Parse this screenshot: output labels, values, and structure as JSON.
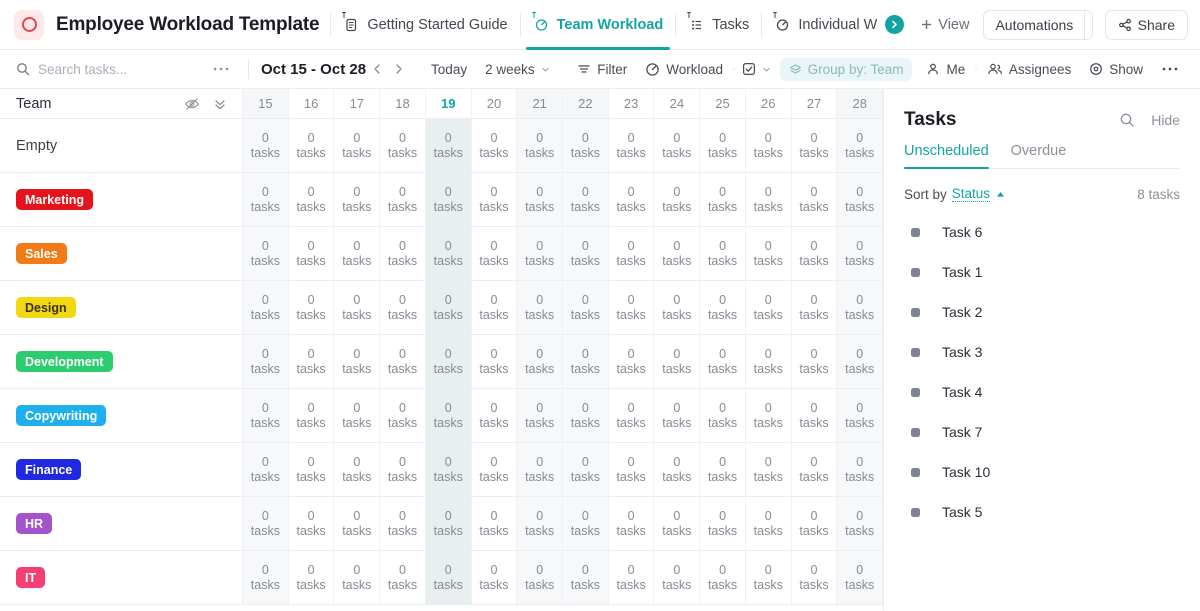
{
  "header": {
    "logo_icon": "clickup-ring-icon",
    "doc_title": "Employee Workload Template",
    "tabs": [
      {
        "label": "Getting Started Guide",
        "icon": "pinned-doc-icon",
        "active": false
      },
      {
        "label": "Team Workload",
        "icon": "pinned-workload-icon",
        "active": true
      },
      {
        "label": "Tasks",
        "icon": "pinned-list-icon",
        "active": false
      },
      {
        "label": "Individual W",
        "icon": "pinned-workload-icon",
        "active": false
      }
    ],
    "more_views_icon": "chevron-right-circle-icon",
    "add_view_label": "View",
    "add_view_icon": "plus-icon",
    "automations_label": "Automations",
    "automations_caret_icon": "chevron-down-icon",
    "share_label": "Share",
    "share_icon": "share-icon",
    "accent_color": "#14a3a3"
  },
  "toolbar": {
    "search_placeholder": "Search tasks...",
    "search_value": "",
    "search_icon": "search-icon",
    "overflow_icon": "ellipsis-icon",
    "date_range": "Oct 15 - Oct 28",
    "prev_icon": "chevron-left-icon",
    "next_icon": "chevron-right-icon",
    "today_label": "Today",
    "zoom_label": "2 weeks",
    "zoom_caret_icon": "caret-down-icon",
    "filter_label": "Filter",
    "filter_icon": "filter-icon",
    "workload_label": "Workload",
    "workload_icon": "gauge-icon",
    "checkbox_icon": "checkbox-checked-icon",
    "checkbox_caret_icon": "caret-down-icon",
    "groupby_label": "Group by: Team",
    "groupby_icon": "layers-icon",
    "me_label": "Me",
    "me_icon": "person-icon",
    "assignees_label": "Assignees",
    "assignees_icon": "people-icon",
    "show_label": "Show",
    "show_icon": "eye-circle-icon",
    "more_icon": "ellipsis-icon"
  },
  "grid": {
    "team_header": "Team",
    "hide_icon": "eye-off-icon",
    "collapse_icon": "double-chevron-down-icon",
    "days": [
      {
        "label": "15",
        "weekend": true,
        "today": false
      },
      {
        "label": "16",
        "weekend": false,
        "today": false
      },
      {
        "label": "17",
        "weekend": false,
        "today": false
      },
      {
        "label": "18",
        "weekend": false,
        "today": false
      },
      {
        "label": "19",
        "weekend": false,
        "today": true
      },
      {
        "label": "20",
        "weekend": false,
        "today": false
      },
      {
        "label": "21",
        "weekend": true,
        "today": false
      },
      {
        "label": "22",
        "weekend": true,
        "today": false
      },
      {
        "label": "23",
        "weekend": false,
        "today": false
      },
      {
        "label": "24",
        "weekend": false,
        "today": false
      },
      {
        "label": "25",
        "weekend": false,
        "today": false
      },
      {
        "label": "26",
        "weekend": false,
        "today": false
      },
      {
        "label": "27",
        "weekend": false,
        "today": false
      },
      {
        "label": "28",
        "weekend": true,
        "today": false
      }
    ],
    "cell_count": "0",
    "cell_unit": "tasks",
    "rows": [
      {
        "label": "Empty",
        "tag": false,
        "color": "",
        "text_color": ""
      },
      {
        "label": "Marketing",
        "tag": true,
        "color": "#e5131c",
        "text_color": "#ffffff"
      },
      {
        "label": "Sales",
        "tag": true,
        "color": "#f27b16",
        "text_color": "#ffffff"
      },
      {
        "label": "Design",
        "tag": true,
        "color": "#f2d813",
        "text_color": "#3c3210"
      },
      {
        "label": "Development",
        "tag": true,
        "color": "#2ecc71",
        "text_color": "#ffffff"
      },
      {
        "label": "Copywriting",
        "tag": true,
        "color": "#1eb0ec",
        "text_color": "#ffffff"
      },
      {
        "label": "Finance",
        "tag": true,
        "color": "#1f2ae0",
        "text_color": "#ffffff"
      },
      {
        "label": "HR",
        "tag": true,
        "color": "#a353cc",
        "text_color": "#ffffff"
      },
      {
        "label": "IT",
        "tag": true,
        "color": "#f43f73",
        "text_color": "#ffffff"
      }
    ]
  },
  "tasks_panel": {
    "title": "Tasks",
    "search_icon": "search-icon",
    "hide_label": "Hide",
    "tabs": [
      {
        "label": "Unscheduled",
        "active": true
      },
      {
        "label": "Overdue",
        "active": false
      }
    ],
    "sort_prefix": "Sort by",
    "sort_key": "Status",
    "sort_dir_icon": "caret-up-icon",
    "count_label": "8 tasks",
    "items": [
      {
        "name": "Task 6"
      },
      {
        "name": "Task 1"
      },
      {
        "name": "Task 2"
      },
      {
        "name": "Task 3"
      },
      {
        "name": "Task 4"
      },
      {
        "name": "Task 7"
      },
      {
        "name": "Task 10"
      },
      {
        "name": "Task 5"
      }
    ]
  }
}
